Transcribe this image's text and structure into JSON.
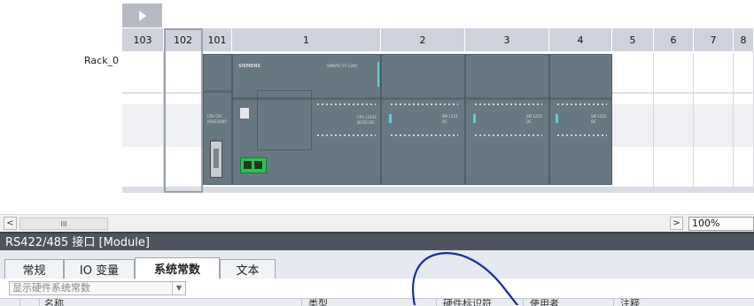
{
  "rack": {
    "name": "Rack_0",
    "slots": [
      "103",
      "102",
      "101",
      "1",
      "2",
      "3",
      "4",
      "5",
      "6",
      "7",
      "8"
    ],
    "modules": [
      {
        "slot": "101",
        "title": "CPU CM",
        "sub": "RS422/485"
      },
      {
        "slot": "1",
        "brand": "SIEMENS",
        "model": "SIMATIC S7-1200",
        "title": "CPU 1214C",
        "sub": "DC/DC/DC"
      },
      {
        "slot": "2",
        "title": "SM 1223",
        "sub": "DC"
      },
      {
        "slot": "3",
        "title": "SM 1223",
        "sub": "DC"
      },
      {
        "slot": "4",
        "title": "SM 1222",
        "sub": "DC"
      }
    ]
  },
  "scrollbar": {
    "left": "<",
    "grip": "III",
    "right": ">"
  },
  "zoom": "100%",
  "properties": {
    "title": "RS422/485 接口 [Module]",
    "tabs": [
      "常规",
      "IO 变量",
      "系统常数",
      "文本"
    ],
    "active_tab": "系统常数",
    "filter": {
      "placeholder": "显示硬件系统常数"
    },
    "columns": [
      "名称",
      "类型",
      "硬件标识符",
      "使用者",
      "注释"
    ]
  },
  "colors": {
    "module": "#677883",
    "header": "#cfd2dc",
    "title_bar": "#4e5561",
    "annotation": "#1a2aa8",
    "connector": "#2fbf5a"
  }
}
